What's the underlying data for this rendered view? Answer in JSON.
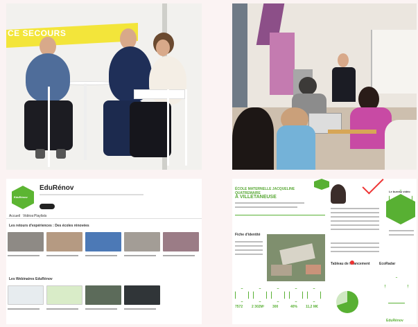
{
  "photo_panel": {
    "banner_text": "CE SECOURS"
  },
  "youtube": {
    "channel_name": "EduRénov",
    "logo_text": "EduRénov",
    "nav_tabs": [
      "Accueil",
      "Vidéos",
      "Playlists"
    ],
    "section1": "Les retours d'expériences : Des écoles rénovées",
    "section2": "Les Webinaires EduRénov"
  },
  "infographic": {
    "title_line1": "ÉCOLE MATERNELLE JACQUELINE QUATREMAIRE",
    "title_line2": "À VILLETANEUSE",
    "fiche_label": "Fiche d'identité",
    "tableau_label": "Tableau de financement",
    "ecoradar_label": "EcoRadar",
    "side_label": "Le bureau vidéo",
    "stats": [
      "7572",
      "2 302M²",
      "300",
      "40%",
      "11,2 M€"
    ],
    "footer_logo": "EduRénov"
  },
  "colors": {
    "accent_green": "#58b033",
    "banner_yellow": "#f3e53a",
    "door_purple": "#c47bb0"
  }
}
